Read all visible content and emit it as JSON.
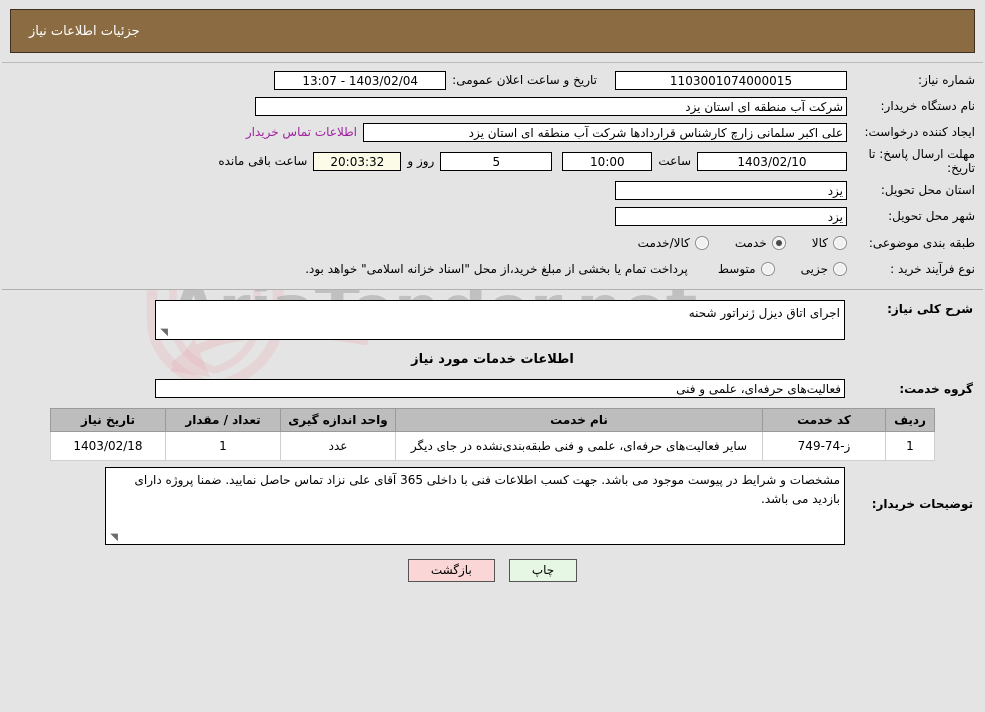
{
  "header": {
    "title": "جزئیات اطلاعات نیاز",
    "bg_color": "#8b6b42",
    "text_color": "#ffffff"
  },
  "watermark": {
    "text": "AriaTender.net"
  },
  "form": {
    "need_number": {
      "label": "شماره نیاز:",
      "value": "1103001074000015"
    },
    "buyer_org": {
      "label": "نام دستگاه خریدار:",
      "value": "شرکت آب منطقه ای استان یزد"
    },
    "creator": {
      "label": "ایجاد کننده درخواست:",
      "value": "علی اکبر سلمانی زارچ کارشناس قراردادها شرکت آب منطقه ای استان یزد"
    },
    "buyer_contact_link": "اطلاعات تماس خریدار",
    "deadline": {
      "label_line1": "مهلت ارسال پاسخ: تا",
      "label_line2": "تاریخ:",
      "date": "1403/02/10",
      "time_label": "ساعت",
      "time": "10:00",
      "days": "5",
      "days_label": "روز و",
      "remaining": "20:03:32",
      "remaining_label": "ساعت باقی مانده"
    },
    "publish": {
      "label": "تاریخ و ساعت اعلان عمومی:",
      "value": "13:07 - 1403/02/04"
    },
    "province": {
      "label": "استان محل تحویل:",
      "value": "یزد"
    },
    "city": {
      "label": "شهر محل تحویل:",
      "value": "یزد"
    },
    "category": {
      "label": "طبقه بندی موضوعی:",
      "options": [
        {
          "label": "کالا",
          "selected": false
        },
        {
          "label": "خدمت",
          "selected": true
        },
        {
          "label": "کالا/خدمت",
          "selected": false
        }
      ]
    },
    "purchase_process": {
      "label": "نوع فرآیند خرید :",
      "options": [
        {
          "label": "جزیی",
          "selected": false
        },
        {
          "label": "متوسط",
          "selected": false
        }
      ],
      "note": "پرداخت تمام یا بخشی از مبلغ خرید،از محل \"اسناد خزانه اسلامی\" خواهد بود."
    }
  },
  "details": {
    "general_desc": {
      "label": "شرح کلی نیاز:",
      "value": "اجرای اتاق دیزل ژنراتور شحنه"
    },
    "services_heading": "اطلاعات خدمات مورد نیاز",
    "service_group": {
      "label": "گروه خدمت:",
      "value": "فعالیت‌های حرفه‌ای، علمی و فنی"
    },
    "table": {
      "columns": [
        "ردیف",
        "کد خدمت",
        "نام خدمت",
        "واحد اندازه گیری",
        "تعداد / مقدار",
        "تاریخ نیاز"
      ],
      "rows": [
        {
          "radif": "1",
          "code": "ز-74-749",
          "name": "سایر فعالیت‌های حرفه‌ای، علمی و فنی طبقه‌بندی‌نشده در جای دیگر",
          "unit": "عدد",
          "qty": "1",
          "date": "1403/02/18"
        }
      ]
    },
    "buyer_comments": {
      "label": "توضیحات خریدار:",
      "value": "مشخصات و شرایط در پیوست موجود می باشد. جهت کسب اطلاعات فنی با داخلی 365 آقای علی نزاد تماس حاصل نمایید. ضمنا پروژه دارای بازدید می باشد."
    }
  },
  "buttons": {
    "print": {
      "label": "چاپ",
      "color": "#e6f7e3"
    },
    "back": {
      "label": "بازگشت",
      "color": "#fbd6d6"
    }
  }
}
